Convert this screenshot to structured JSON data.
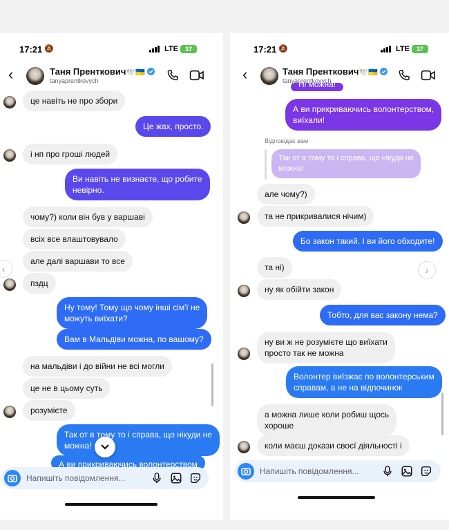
{
  "status": {
    "time": "17:21",
    "network": "LTE",
    "battery": "37"
  },
  "chat": {
    "name": "Таня Пренткович",
    "name_decor": "🕊️🇺🇦",
    "username": "tanyaprentkovych"
  },
  "composer": {
    "placeholder": "Напишіть повідомлення..."
  },
  "left": {
    "messages": [
      {
        "text": "це навіть не про збори"
      },
      {
        "text": "Це жах, просто."
      },
      {
        "text": "і нп про гроші людей"
      },
      {
        "line1": "Ви навіть не визнаєте, що робите",
        "line2": "невірно."
      },
      {
        "text": "чому?) коли він був у варшаві"
      },
      {
        "text": "всіх все влаштовувало"
      },
      {
        "text": "але далі варшави то все"
      },
      {
        "text": "пздц"
      },
      {
        "line1": "Ну тому! Тому що чому інші сім'ї не",
        "line2": "можуть виїхати?"
      },
      {
        "text": "Вам в Мальдіви можна, по вашому?"
      },
      {
        "text": "на мальдіви і до війни не всі могли"
      },
      {
        "text": "це не в цьому суть"
      },
      {
        "text": "розумієте"
      },
      {
        "line1": "Так от в тому то і справа, що нікуди не",
        "line2": "можна!"
      },
      {
        "text": "А ви прикриваючись волонтерством"
      }
    ]
  },
  "right": {
    "messages": [
      {
        "text": "Ні можна!"
      },
      {
        "line1": "А ви прикриваючись волонтерством,",
        "line2": "виїхали!"
      },
      {
        "text": "але чому?)"
      },
      {
        "text": "та не прикривалися нічим)"
      },
      {
        "text": "Бо закон такий. І ви його обходите!"
      },
      {
        "text": "та ні)"
      },
      {
        "text": "ну як обійти закон"
      },
      {
        "text": "Тобто, для вас закону нема?"
      },
      {
        "line1": "ну ви ж не розумієте що виїхати",
        "line2": "просто так не можна"
      },
      {
        "line1": "Волонтер виїзжає по волонтерським",
        "line2": "справам, а не на відпочинок"
      },
      {
        "line1": "а можна лише коли робиш щось",
        "line2": "хороше"
      },
      {
        "text": "коли маєш докази своєї діяльності і"
      }
    ],
    "reply": {
      "label": "Відповідає вам",
      "line1": "Так от в тому то і справа, що нікуди не",
      "line2": "можна!"
    }
  },
  "colors": {
    "purple": "#7b36e6",
    "violet": "#5b48ec",
    "blue": "#2f6cf5",
    "incoming": "#efefef"
  },
  "icons": [
    "chevron-left-icon",
    "verified-icon",
    "phone-icon",
    "video-icon",
    "camera-icon",
    "microphone-icon",
    "gallery-icon",
    "sticker-icon",
    "chevron-down-icon",
    "chevron-right-icon"
  ]
}
